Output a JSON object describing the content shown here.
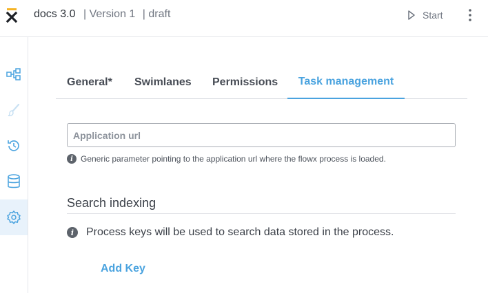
{
  "header": {
    "app_title": "docs 3.0",
    "version": "| Version 1",
    "status": "| draft",
    "start_label": "Start"
  },
  "sidebar": {
    "items": [
      {
        "icon": "process-flow-icon"
      },
      {
        "icon": "brush-icon"
      },
      {
        "icon": "history-icon"
      },
      {
        "icon": "database-icon"
      },
      {
        "icon": "gear-icon",
        "active": true
      }
    ]
  },
  "tabs": [
    {
      "label": "General*"
    },
    {
      "label": "Swimlanes"
    },
    {
      "label": "Permissions"
    },
    {
      "label": "Task management",
      "active": true
    }
  ],
  "task_management": {
    "app_url_value": "",
    "app_url_placeholder": "Application url",
    "app_url_hint": "Generic parameter pointing to the application url where the flowx process is loaded."
  },
  "search_indexing": {
    "title": "Search indexing",
    "info": "Process keys will be used to search data stored in the process.",
    "add_key_label": "Add Key"
  },
  "colors": {
    "accent": "#4aa3df",
    "logo_accent": "#f5b325",
    "active_sidebar_bg": "#e8f2fb"
  }
}
